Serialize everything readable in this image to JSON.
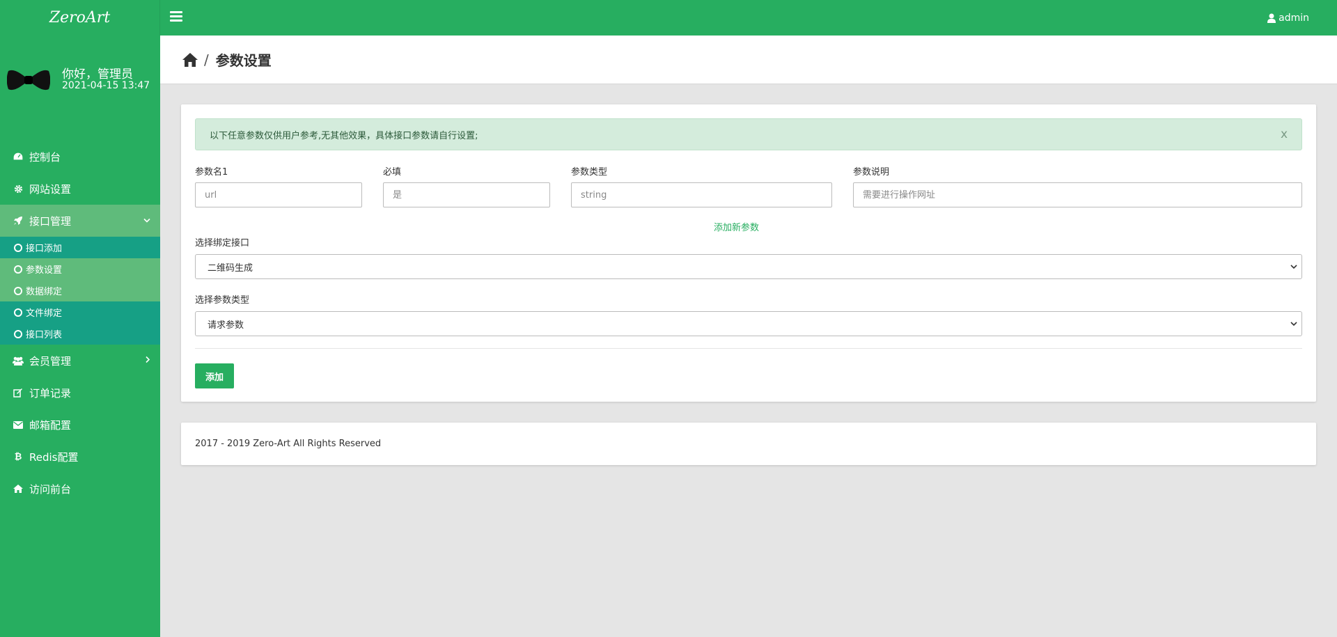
{
  "app": {
    "logo_text": "ZeroArt",
    "user_name": "admin"
  },
  "profile": {
    "greeting": "你好，管理员",
    "login_time": "2021-04-15 13:47"
  },
  "sidebar": {
    "items": [
      {
        "label": "控制台",
        "icon": "dashboard-icon"
      },
      {
        "label": "网站设置",
        "icon": "gear-icon"
      },
      {
        "label": "接口管理",
        "icon": "rocket-icon",
        "expanded": true
      },
      {
        "label": "会员管理",
        "icon": "users-icon"
      },
      {
        "label": "订单记录",
        "icon": "edit-icon"
      },
      {
        "label": "邮箱配置",
        "icon": "envelope-icon"
      },
      {
        "label": "Redis配置",
        "icon": "bitcoin-icon"
      },
      {
        "label": "访问前台",
        "icon": "home-icon"
      }
    ],
    "sub_items": [
      {
        "label": "接口添加"
      },
      {
        "label": "参数设置",
        "active": true
      },
      {
        "label": "数据绑定"
      },
      {
        "label": "文件绑定"
      },
      {
        "label": "接口列表"
      }
    ]
  },
  "breadcrumb": {
    "separator": "/",
    "title": "参数设置"
  },
  "form": {
    "alert_text": "以下任意参数仅供用户参考,无其他效果，具体接口参数请自行设置;",
    "alert_close": "x",
    "fields": [
      {
        "label": "参数名1",
        "placeholder": "url"
      },
      {
        "label": "必填",
        "placeholder": "是"
      },
      {
        "label": "参数类型",
        "placeholder": "string"
      },
      {
        "label": "参数说明",
        "placeholder": "需要进行操作网址"
      }
    ],
    "add_param_link": "添加新参数",
    "bind_interface": {
      "label": "选择绑定接口",
      "selected": "二维码生成"
    },
    "param_type": {
      "label": "选择参数类型",
      "selected": "请求参数"
    },
    "submit_label": "添加"
  },
  "footer": {
    "text": "2017 - 2019 Zero-Art All Rights Reserved"
  },
  "colors": {
    "primary": "#27ae60",
    "sidebar_active": "#5fbb7b",
    "sidebar_sub_dark": "#16a085",
    "alert_bg": "#d4ecdc"
  }
}
